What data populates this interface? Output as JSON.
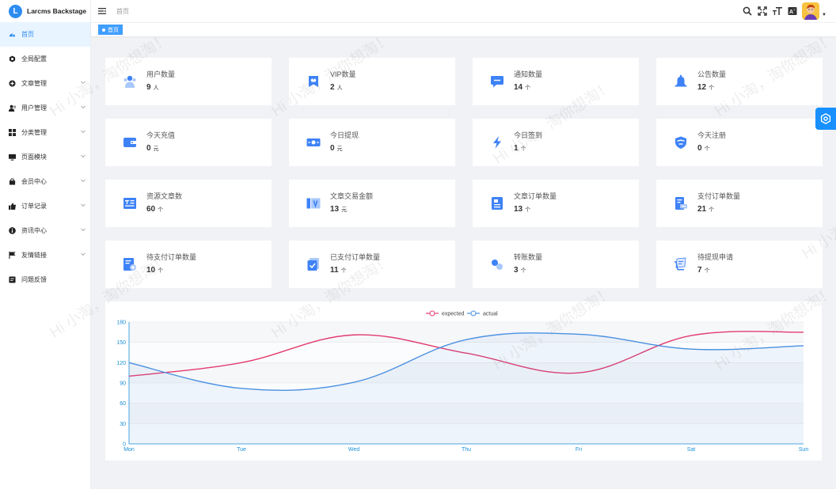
{
  "app": {
    "name": "Larcms Backstage",
    "logo_letter": "L"
  },
  "header": {
    "breadcrumb": "首页"
  },
  "tags": [
    {
      "label": "首页"
    }
  ],
  "sidebar": {
    "items": [
      {
        "label": "首页",
        "icon": "dashboard-icon",
        "active": true,
        "expandable": false
      },
      {
        "label": "全局配置",
        "icon": "gear-icon",
        "active": false,
        "expandable": false
      },
      {
        "label": "文章管理",
        "icon": "circle-plus-icon",
        "active": false,
        "expandable": true
      },
      {
        "label": "用户管理",
        "icon": "user-icon",
        "active": false,
        "expandable": true
      },
      {
        "label": "分类管理",
        "icon": "grid-icon",
        "active": false,
        "expandable": true
      },
      {
        "label": "页面模块",
        "icon": "monitor-icon",
        "active": false,
        "expandable": true
      },
      {
        "label": "会员中心",
        "icon": "bag-icon",
        "active": false,
        "expandable": true
      },
      {
        "label": "订单记录",
        "icon": "thumb-icon",
        "active": false,
        "expandable": true
      },
      {
        "label": "资讯中心",
        "icon": "info-icon",
        "active": false,
        "expandable": true
      },
      {
        "label": "友情链接",
        "icon": "flag-icon",
        "active": false,
        "expandable": true
      },
      {
        "label": "问题反馈",
        "icon": "feedback-icon",
        "active": false,
        "expandable": false
      }
    ]
  },
  "cards": [
    {
      "title": "用户数量",
      "value": "9",
      "unit": "人",
      "icon": "users-icon"
    },
    {
      "title": "VIP数量",
      "value": "2",
      "unit": "人",
      "icon": "vip-icon"
    },
    {
      "title": "通知数量",
      "value": "14",
      "unit": "个",
      "icon": "message-icon"
    },
    {
      "title": "公告数量",
      "value": "12",
      "unit": "个",
      "icon": "bell-icon"
    },
    {
      "title": "今天充值",
      "value": "0",
      "unit": "元",
      "icon": "wallet-icon"
    },
    {
      "title": "今日提现",
      "value": "0",
      "unit": "元",
      "icon": "cash-icon"
    },
    {
      "title": "今日签到",
      "value": "1",
      "unit": "个",
      "icon": "lightning-icon"
    },
    {
      "title": "今天注册",
      "value": "0",
      "unit": "个",
      "icon": "shield-icon"
    },
    {
      "title": "资源文章数",
      "value": "60",
      "unit": "个",
      "icon": "article-icon"
    },
    {
      "title": "文章交易金额",
      "value": "13",
      "unit": "元",
      "icon": "trade-icon"
    },
    {
      "title": "文章订单数量",
      "value": "13",
      "unit": "个",
      "icon": "order-icon"
    },
    {
      "title": "支付订单数量",
      "value": "21",
      "unit": "个",
      "icon": "pay-order-icon"
    },
    {
      "title": "待支付订单数量",
      "value": "10",
      "unit": "个",
      "icon": "pending-order-icon"
    },
    {
      "title": "已支付订单数量",
      "value": "11",
      "unit": "个",
      "icon": "paid-order-icon"
    },
    {
      "title": "转账数量",
      "value": "3",
      "unit": "个",
      "icon": "transfer-icon"
    },
    {
      "title": "待提现申请",
      "value": "7",
      "unit": "个",
      "icon": "withdraw-icon"
    }
  ],
  "watermark": "Hi 小淘，淘你想淘！",
  "colors": {
    "primary": "#2d8cf0",
    "icon_blue": "#3e82f7",
    "expected": "#e23c6f",
    "actual": "#4a90e2"
  },
  "chart_data": {
    "type": "line",
    "categories": [
      "Mon",
      "Tue",
      "Wed",
      "Thu",
      "Fri",
      "Sat",
      "Sun"
    ],
    "series": [
      {
        "name": "expected",
        "values": [
          100,
          120,
          161,
          134,
          105,
          160,
          165
        ],
        "color": "#e23c6f"
      },
      {
        "name": "actual",
        "values": [
          120,
          82,
          91,
          154,
          162,
          140,
          145
        ],
        "color": "#4a90e2",
        "area": true
      }
    ],
    "ylim": [
      0,
      180
    ],
    "yticks": [
      0,
      30,
      60,
      90,
      120,
      150,
      180
    ],
    "title": "",
    "xlabel": "",
    "ylabel": "",
    "legend": "top-center",
    "smooth": true
  }
}
